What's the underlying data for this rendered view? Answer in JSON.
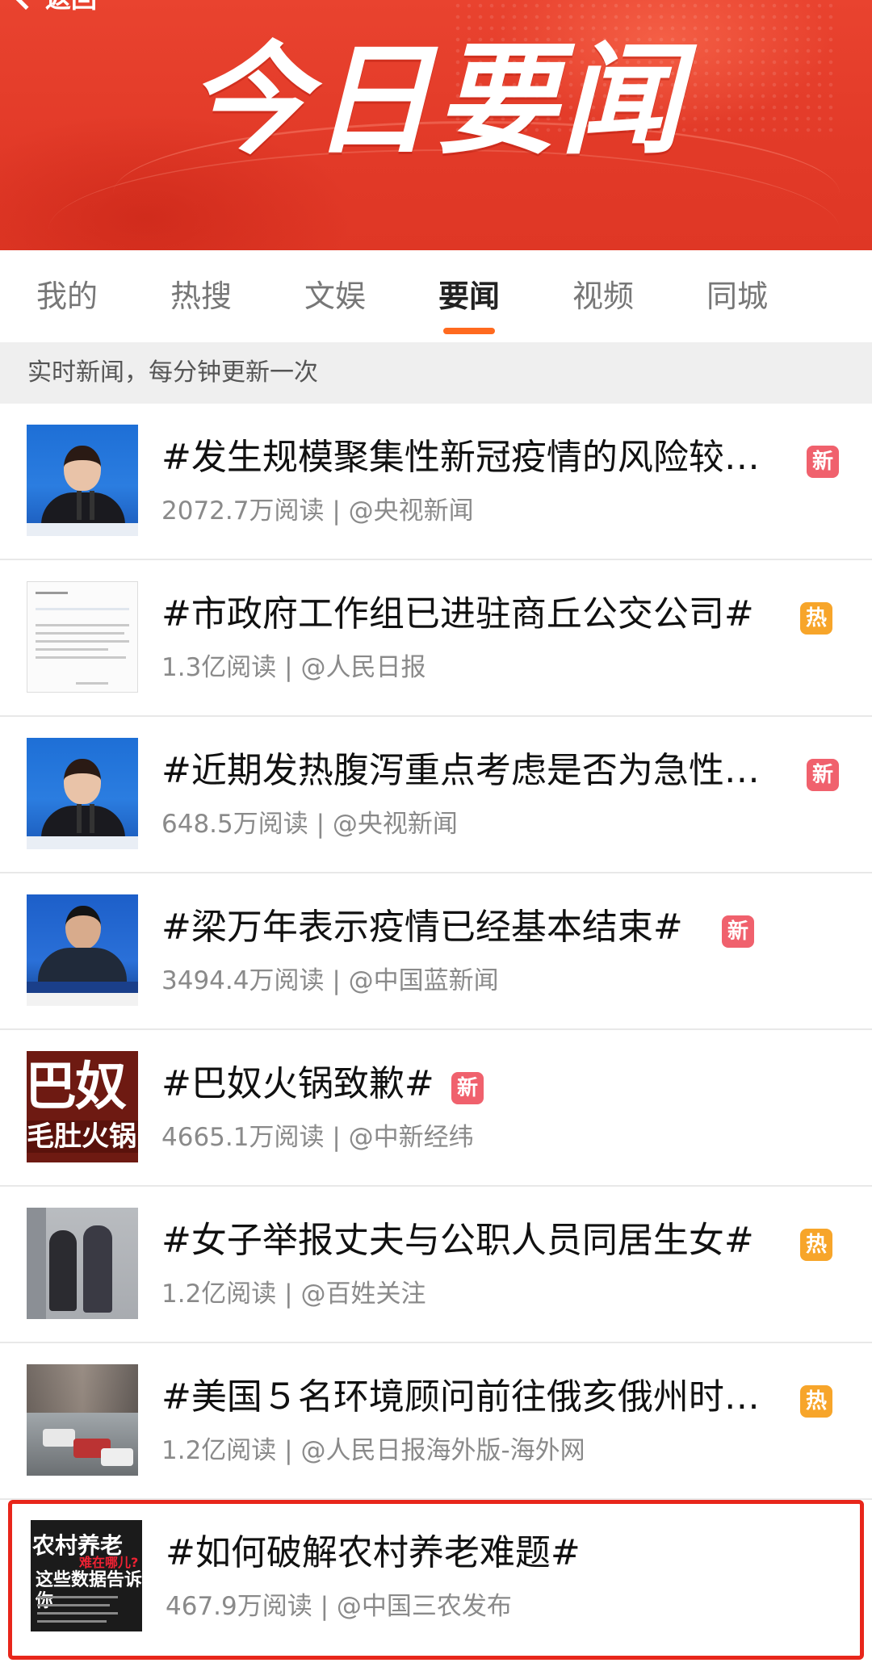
{
  "banner": {
    "back_label": "返回",
    "title": "今日要闻"
  },
  "tabs": [
    {
      "label": "我的"
    },
    {
      "label": "热搜"
    },
    {
      "label": "文娱"
    },
    {
      "label": "要闻",
      "active": true
    },
    {
      "label": "视频"
    },
    {
      "label": "同城"
    }
  ],
  "subheader": "实时新闻，每分钟更新一次",
  "colors": {
    "banner": "#e23a28",
    "tab_underline": "#ff6a1f",
    "badge_new": "#f0616d",
    "badge_hot": "#f7a52a",
    "highlight_border": "#e8261b"
  },
  "items": [
    {
      "title": "#发生规模聚集性新冠疫情的风险较…",
      "badge": "新",
      "badge_type": "new",
      "meta": "2072.7万阅读 | @央视新闻",
      "thumb": "woman-press-conference"
    },
    {
      "title": "#市政府工作组已进驻商丘公交公司#",
      "badge": "热",
      "badge_type": "hot",
      "meta": "1.3亿阅读 | @人民日报",
      "thumb": "document"
    },
    {
      "title": "#近期发热腹泻重点考虑是否为急性…",
      "badge": "新",
      "badge_type": "new",
      "meta": "648.5万阅读 | @央视新闻",
      "thumb": "woman-press-conference"
    },
    {
      "title": "#梁万年表示疫情已经基本结束#",
      "badge": "新",
      "badge_type": "new",
      "meta": "3494.4万阅读 | @中国蓝新闻",
      "thumb": "man-press-conference"
    },
    {
      "title": "#巴奴火锅致歉#",
      "badge": "新",
      "badge_type": "new",
      "meta": "4665.1万阅读 | @中新经纬",
      "thumb": "banu-text"
    },
    {
      "title": "#女子举报丈夫与公职人员同居生女#",
      "badge": "热",
      "badge_type": "hot",
      "meta": "1.2亿阅读 | @百姓关注",
      "thumb": "cctv-people"
    },
    {
      "title": "#美国５名环境顾问前往俄亥俄州时…",
      "badge": "热",
      "badge_type": "hot",
      "meta": "1.2亿阅读 | @人民日报海外版-海外网",
      "thumb": "street-cars"
    },
    {
      "title": "#如何破解农村养老难题#",
      "badge": "",
      "badge_type": "",
      "meta": "467.9万阅读 | @中国三农发布",
      "thumb": "rural-elderly-graphic",
      "highlighted": true
    }
  ],
  "thumb_text": {
    "banu_big": "巴奴",
    "banu_small": "毛肚火锅",
    "rural_1": "农村养老",
    "rural_2": "难在哪儿?",
    "rural_3": "这些数据告诉你"
  }
}
